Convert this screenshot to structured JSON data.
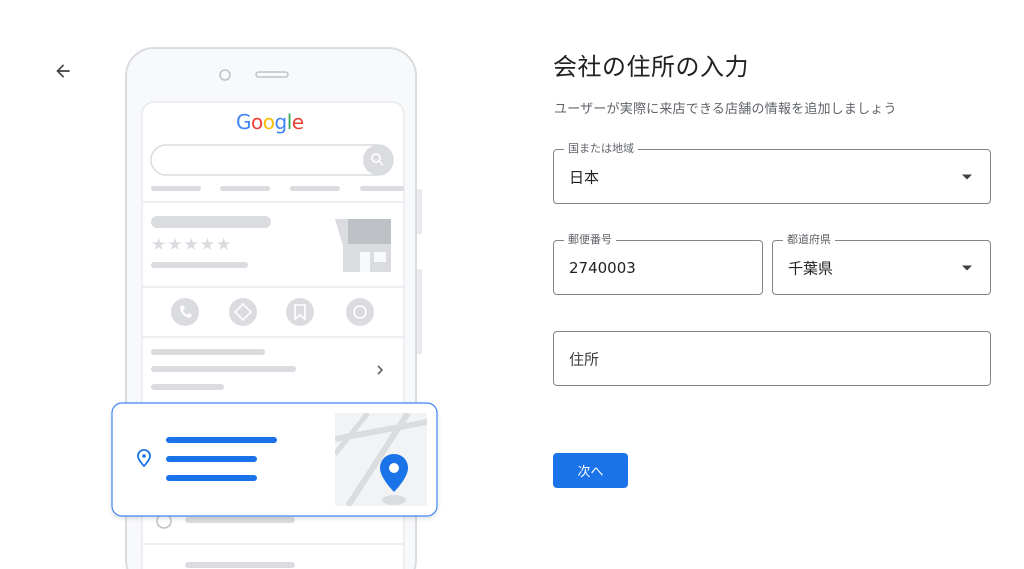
{
  "header": {
    "back_icon": "arrow-back-icon"
  },
  "illustration": {
    "logo": "Google",
    "stars": "★★★★★",
    "chevron": "›",
    "colors": {
      "blue": "#4285f4",
      "red": "#ea4335",
      "yellow": "#fbbc05",
      "green": "#34a853",
      "pin": "#1a73e8"
    }
  },
  "form": {
    "title": "会社の住所の入力",
    "subtitle": "ユーザーが実際に来店できる店舗の情報を追加しましょう",
    "country": {
      "label": "国または地域",
      "value": "日本"
    },
    "postal_code": {
      "label": "郵便番号",
      "value": "2740003"
    },
    "prefecture": {
      "label": "都道府県",
      "value": "千葉県"
    },
    "address": {
      "placeholder": "住所"
    },
    "next_label": "次へ"
  }
}
